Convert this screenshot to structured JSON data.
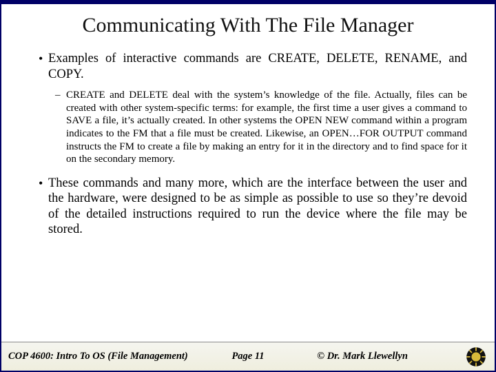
{
  "title": "Communicating With The File Manager",
  "bullets": {
    "b1": "Examples of interactive commands are CREATE, DELETE, RENAME, and COPY.",
    "sub1": "CREATE and DELETE deal with the system’s knowledge of the file.  Actually, files can be created with other system-specific terms: for example, the first time a user gives a command to SAVE a file, it’s actually created.  In other systems the OPEN NEW command within a program indicates to the FM that a file must be created.  Likewise, an OPEN…FOR OUTPUT command instructs the FM to create a file by making an entry for it in the directory and to find space for it on the secondary memory.",
    "b2": "These commands and many more, which are the interface between the user and the hardware, were designed to be as simple as possible to use so they’re devoid of the detailed instructions required to run the device where the file may be stored."
  },
  "footer": {
    "course": "COP 4600: Intro To OS  (File Management)",
    "page": "Page 11",
    "copyright": "© Dr. Mark Llewellyn"
  }
}
